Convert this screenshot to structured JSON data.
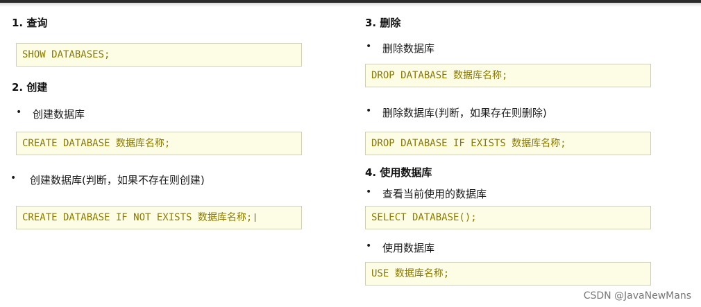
{
  "left": {
    "sec1_title": "1. 查询",
    "sec1_code": "SHOW DATABASES;",
    "sec2_title": "2. 创建",
    "sec2_item1": "创建数据库",
    "sec2_code1": "CREATE DATABASE 数据库名称;",
    "sec2_item2": "创建数据库(判断，如果不存在则创建)",
    "sec2_code2": "CREATE DATABASE IF NOT EXISTS 数据库名称;"
  },
  "right": {
    "sec3_title": "3. 删除",
    "sec3_item1": "删除数据库",
    "sec3_code1": "DROP DATABASE 数据库名称;",
    "sec3_item2": "删除数据库(判断，如果存在则删除)",
    "sec3_code2": "DROP DATABASE IF EXISTS 数据库名称;",
    "sec4_title": "4. 使用数据库",
    "sec4_item1": "查看当前使用的数据库",
    "sec4_code1": "SELECT DATABASE();",
    "sec4_item2": "使用数据库",
    "sec4_code2": "USE 数据库名称;"
  },
  "bullet_char": "•",
  "watermark": "CSDN @JavaNewMans",
  "colors": {
    "code_bg": "#fdfde6",
    "code_text": "#8a7a00",
    "code_border": "#cfcfb8"
  }
}
